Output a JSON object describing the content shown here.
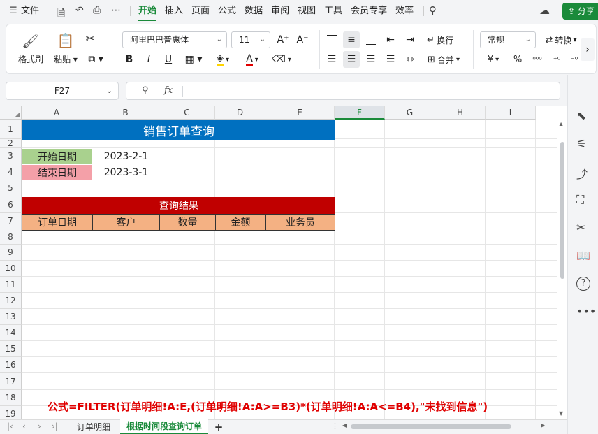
{
  "menu": {
    "file_label": "文件",
    "tabs": [
      "开始",
      "插入",
      "页面",
      "公式",
      "数据",
      "审阅",
      "视图",
      "工具",
      "会员专享",
      "效率"
    ],
    "active_tab": "开始",
    "share_label": "分享"
  },
  "ribbon": {
    "format_painter": "格式刷",
    "paste": "粘贴",
    "font_name": "阿里巴巴普惠体",
    "font_size": "11",
    "wrap": "换行",
    "merge": "合并",
    "number_format": "常规",
    "convert": "转换",
    "currency_symbol": "¥",
    "percent_symbol": "%",
    "bold": "B",
    "italic": "I",
    "underline": "U",
    "font_grow": "A⁺",
    "font_shrink": "A⁻",
    "font_color_letter": "A"
  },
  "formula_bar": {
    "cell_ref": "F27",
    "fx_label": "fx",
    "value": ""
  },
  "grid": {
    "columns": [
      "A",
      "B",
      "C",
      "D",
      "E",
      "F",
      "G",
      "H",
      "I"
    ],
    "selected_column": "F",
    "rows": [
      "1",
      "2",
      "3",
      "4",
      "5",
      "6",
      "7",
      "8",
      "9",
      "10",
      "11",
      "12",
      "13",
      "14",
      "15",
      "16",
      "17",
      "18",
      "19"
    ]
  },
  "sheet": {
    "title": "销售订单查询",
    "start_label": "开始日期",
    "start_value": "2023-2-1",
    "end_label": "结束日期",
    "end_value": "2023-3-1",
    "result_title": "查询结果",
    "headers": [
      "订单日期",
      "客户",
      "数量",
      "金额",
      "业务员"
    ],
    "formula_note": "公式=FILTER(订单明细!A:E,(订单明细!A:A>=B3)*(订单明细!A:A<=B4),\"未找到信息\")"
  },
  "sheet_tabs": {
    "tabs": [
      "订单明细",
      "根据时间段查询订单"
    ],
    "active": "根据时间段查询订单",
    "add_label": "+"
  },
  "colors": {
    "accent_green": "#1a8a3a",
    "title_blue": "#0070c0",
    "start_green": "#a9d18e",
    "end_pink": "#f4a0a8",
    "result_red": "#c00000",
    "header_orange": "#f4b183",
    "formula_red": "#e00000"
  }
}
